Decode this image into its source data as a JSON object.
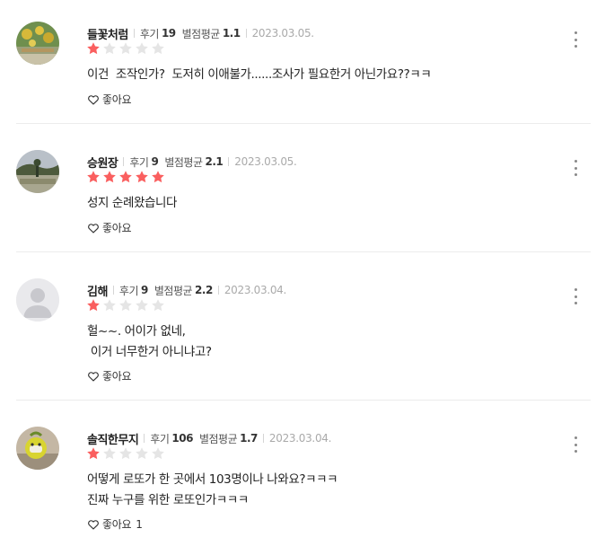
{
  "colors": {
    "star_on": "#fa5f5f",
    "star_off": "#e5e5e5"
  },
  "labels": {
    "review_count": "후기",
    "avg_rating": "별점평균",
    "like": "좋아요"
  },
  "reviews": [
    {
      "nickname": "들꽃처럼",
      "review_count": "19",
      "avg_rating": "1.1",
      "date": "2023.03.05.",
      "rating": 1,
      "body": "이건  조작인가?  도저히 이애불가......조사가 필요한거 아닌가요??ㅋㅋ",
      "likes": "",
      "avatar": "flower-photo"
    },
    {
      "nickname": "승원장",
      "review_count": "9",
      "avg_rating": "2.1",
      "date": "2023.03.05.",
      "rating": 5,
      "body": "성지 순례왔습니다",
      "likes": "",
      "avatar": "landscape-photo"
    },
    {
      "nickname": "김해",
      "review_count": "9",
      "avg_rating": "2.2",
      "date": "2023.03.04.",
      "rating": 1,
      "body": "헐~~. 어이가 없네,\n 이거 너무한거 아니냐고?",
      "likes": "",
      "avatar": "default-person"
    },
    {
      "nickname": "솔직한무지",
      "review_count": "106",
      "avg_rating": "1.7",
      "date": "2023.03.04.",
      "rating": 1,
      "body": "어떻게 로또가 한 곳에서 103명이나 나와요?ㅋㅋㅋ\n진짜 누구를 위한 로또인가ㅋㅋㅋ",
      "likes": "1",
      "avatar": "character-photo"
    }
  ]
}
